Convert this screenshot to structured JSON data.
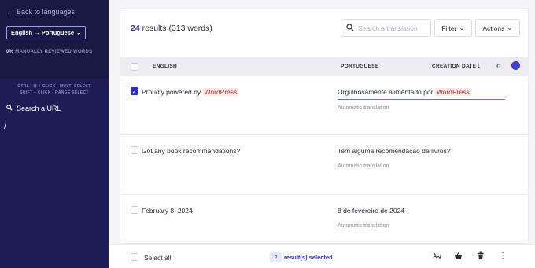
{
  "sidebar": {
    "back_label": "Back to languages",
    "language_pair": "English → Portuguese",
    "reviewed_percent": "0%",
    "reviewed_label": "MANUALLY REVIEWED WORDS",
    "shortcut_multi": "CTRL | ⌘ + CLICK - MULTI SELECT",
    "shortcut_range": "SHIFT + CLICK - RANGE SELECT",
    "search_url_label": "Search a URL",
    "path": "/"
  },
  "toolbar": {
    "results_count": "24",
    "results_label": "results (313 words)",
    "search_placeholder": "Search a translation",
    "filter_label": "Filter",
    "actions_label": "Actions"
  },
  "table": {
    "col_english": "ENGLISH",
    "col_portuguese": "PORTUGUESE",
    "col_creation_date": "CREATION DATE",
    "rows": [
      {
        "checked": true,
        "source_text": "Proudly powered by",
        "source_highlight": "WordPress",
        "target_text": "Orgulhosamente alimentado por",
        "target_highlight": "WordPress",
        "status": "Automatic translation"
      },
      {
        "checked": false,
        "source_text": "Got any book recommendations?",
        "target_text": "Tem alguma recomendação de livros?",
        "status": "Automatic translation"
      },
      {
        "checked": false,
        "source_text": "February 8, 2024",
        "target_text": "8 de fevereiro de 2024",
        "status": "Automatic translation"
      }
    ]
  },
  "footer": {
    "select_all_label": "Select all",
    "selected_count": "2",
    "selected_label": "result(s) selected"
  },
  "colors": {
    "accent": "#2a2fcf",
    "sidebar_bg": "#1d1c54",
    "highlight_bg": "#fbe7e6"
  }
}
